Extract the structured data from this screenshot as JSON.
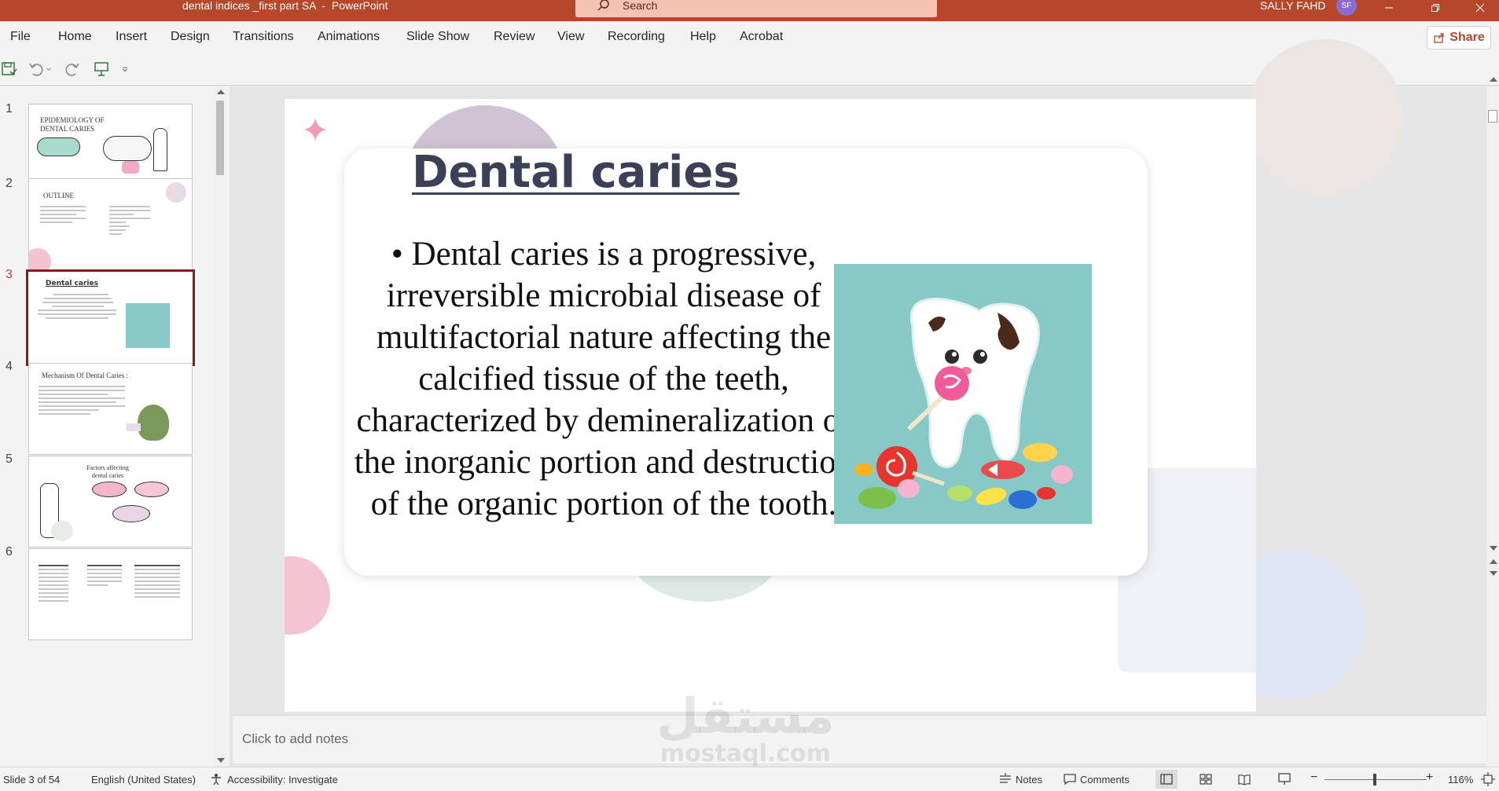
{
  "window": {
    "title": "dental indices _first part SA  -  PowerPoint",
    "search_placeholder": "Search",
    "user_name": "SALLY FAHD",
    "user_initials": "SF"
  },
  "ribbon": {
    "tabs": [
      "File",
      "Home",
      "Insert",
      "Design",
      "Transitions",
      "Animations",
      "Slide Show",
      "Review",
      "View",
      "Recording",
      "Help",
      "Acrobat"
    ],
    "share_label": "Share"
  },
  "thumbnails": [
    {
      "number": "1",
      "title": "EPIDEMIOLOGY OF DENTAL CARIES"
    },
    {
      "number": "2",
      "title": "OUTLINE"
    },
    {
      "number": "3",
      "title": "Dental caries"
    },
    {
      "number": "4",
      "title": "Mechanism Of Dental Caries :"
    },
    {
      "number": "5",
      "title": "Factors affecting dental caries"
    },
    {
      "number": "6",
      "title": ""
    }
  ],
  "slide": {
    "title": "Dental caries",
    "body": "• Dental caries is a progressive, irreversible microbial disease of multifactorial nature affecting the calcified tissue of the teeth, characterized by demineralization of the inorganic portion and destruction of the organic portion of the tooth."
  },
  "notes": {
    "placeholder": "Click to add notes"
  },
  "status": {
    "slide_info": "Slide 3 of 54",
    "language": "English (United States)",
    "accessibility": "Accessibility: Investigate",
    "notes_label": "Notes",
    "comments_label": "Comments",
    "zoom": "116%"
  },
  "watermark": {
    "arabic": "مستقل",
    "latin": "mostaql.com"
  },
  "colors": {
    "accent": "#b7472a",
    "slide_title": "#3a4157",
    "image_bg": "#86c9c6"
  }
}
